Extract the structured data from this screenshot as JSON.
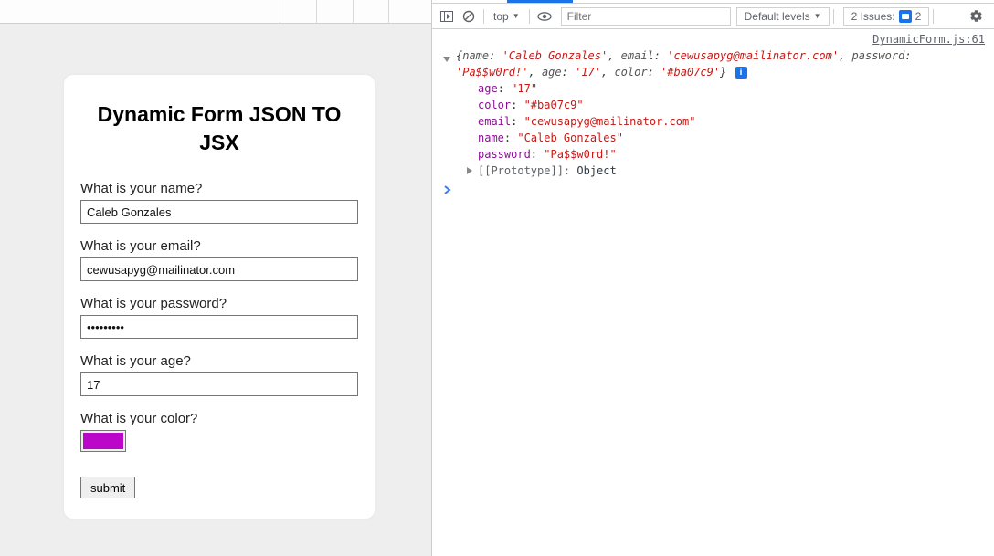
{
  "form": {
    "title": "Dynamic Form JSON TO JSX",
    "fields": [
      {
        "key": "name",
        "label": "What is your name?",
        "type": "text",
        "value": "Caleb Gonzales"
      },
      {
        "key": "email",
        "label": "What is your email?",
        "type": "text",
        "value": "cewusapyg@mailinator.com"
      },
      {
        "key": "password",
        "label": "What is your password?",
        "type": "password",
        "value": "Pa$$w0rd!"
      },
      {
        "key": "age",
        "label": "What is your age?",
        "type": "text",
        "value": "17"
      },
      {
        "key": "color",
        "label": "What is your color?",
        "type": "color",
        "value": "#ba07c9"
      }
    ],
    "submit_label": "submit"
  },
  "toolbar": {
    "context_label": "top",
    "filter_placeholder": "Filter",
    "levels_label": "Default levels",
    "issues_label": "2 Issues:",
    "issues_count": "2"
  },
  "console": {
    "source": "DynamicForm.js:61",
    "summary": {
      "pairs": [
        {
          "k": "name",
          "v": "'Caleb Gonzales'"
        },
        {
          "k": "email",
          "v": "'cewusapyg@mailinator.com'"
        },
        {
          "k": "password",
          "v": "'Pa$$w0rd!'"
        },
        {
          "k": "age",
          "v": "'17'"
        },
        {
          "k": "color",
          "v": "'#ba07c9'"
        }
      ]
    },
    "expanded": [
      {
        "k": "age",
        "v": "\"17\""
      },
      {
        "k": "color",
        "v": "\"#ba07c9\""
      },
      {
        "k": "email",
        "v": "\"cewusapyg@mailinator.com\""
      },
      {
        "k": "name",
        "v": "\"Caleb Gonzales\""
      },
      {
        "k": "password",
        "v": "\"Pa$$w0rd!\""
      }
    ],
    "proto_label": "[[Prototype]]",
    "proto_value": "Object",
    "prompt": ">"
  }
}
